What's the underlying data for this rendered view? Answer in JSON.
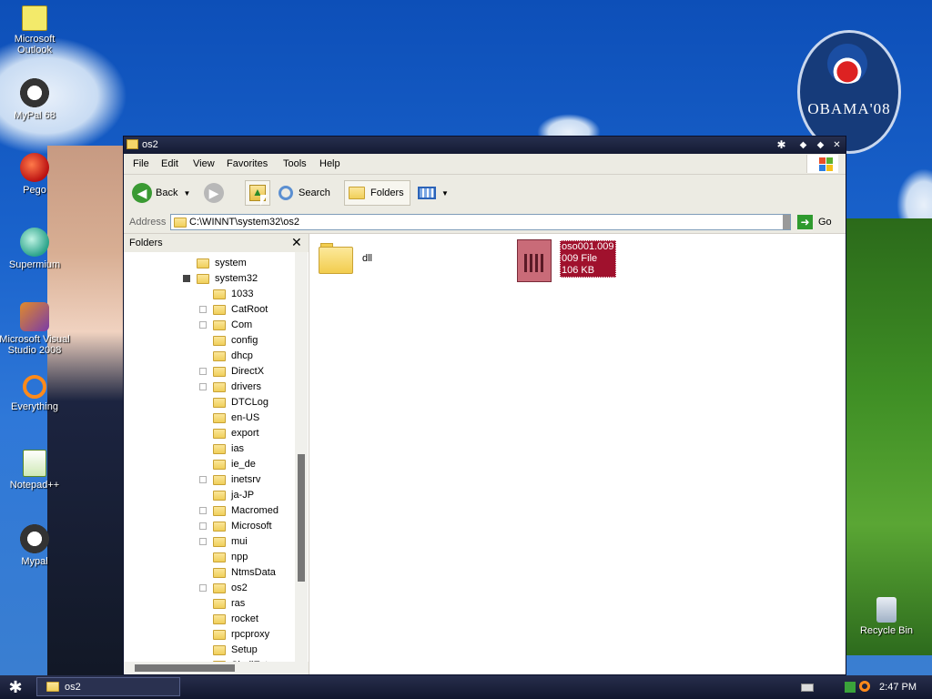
{
  "desktop": {
    "icons": [
      {
        "label": "Microsoft Outlook",
        "icon": "outlook-icon"
      },
      {
        "label": "MyPal 68",
        "icon": "mypal-icon"
      },
      {
        "label": "Pego",
        "icon": "pego-icon"
      },
      {
        "label": "Supermium",
        "icon": "supermium-icon"
      },
      {
        "label": "Microsoft Visual Studio 2008",
        "icon": "visual-studio-icon"
      },
      {
        "label": "Everything",
        "icon": "everything-icon"
      },
      {
        "label": "Notepad++",
        "icon": "notepad-plus-plus-icon"
      },
      {
        "label": "Mypal",
        "icon": "mypal-icon"
      }
    ],
    "recycle_bin": "Recycle Bin",
    "seal_text": "OBAMA'08"
  },
  "window": {
    "title": "os2",
    "menu": [
      "File",
      "Edit",
      "View",
      "Favorites",
      "Tools",
      "Help"
    ],
    "toolbar": {
      "back_label": "Back",
      "search_label": "Search",
      "folders_label": "Folders"
    },
    "address": {
      "label": "Address",
      "value": "C:\\WINNT\\system32\\os2",
      "go_label": "Go"
    },
    "folders_pane": {
      "title": "Folders",
      "items": [
        {
          "label": "system",
          "level": 0,
          "expander": false
        },
        {
          "label": "system32",
          "level": 0,
          "expander": true
        },
        {
          "label": "1033",
          "level": 1,
          "expander": false
        },
        {
          "label": "CatRoot",
          "level": 1,
          "expander": true
        },
        {
          "label": "Com",
          "level": 1,
          "expander": true
        },
        {
          "label": "config",
          "level": 1,
          "expander": false
        },
        {
          "label": "dhcp",
          "level": 1,
          "expander": false
        },
        {
          "label": "DirectX",
          "level": 1,
          "expander": true
        },
        {
          "label": "drivers",
          "level": 1,
          "expander": true
        },
        {
          "label": "DTCLog",
          "level": 1,
          "expander": false
        },
        {
          "label": "en-US",
          "level": 1,
          "expander": false
        },
        {
          "label": "export",
          "level": 1,
          "expander": false
        },
        {
          "label": "ias",
          "level": 1,
          "expander": false
        },
        {
          "label": "ie_de",
          "level": 1,
          "expander": false
        },
        {
          "label": "inetsrv",
          "level": 1,
          "expander": true
        },
        {
          "label": "ja-JP",
          "level": 1,
          "expander": false
        },
        {
          "label": "Macromed",
          "level": 1,
          "expander": true
        },
        {
          "label": "Microsoft",
          "level": 1,
          "expander": true
        },
        {
          "label": "mui",
          "level": 1,
          "expander": true
        },
        {
          "label": "npp",
          "level": 1,
          "expander": false
        },
        {
          "label": "NtmsData",
          "level": 1,
          "expander": false
        },
        {
          "label": "os2",
          "level": 1,
          "expander": true
        },
        {
          "label": "ras",
          "level": 1,
          "expander": false
        },
        {
          "label": "rocket",
          "level": 1,
          "expander": false
        },
        {
          "label": "rpcproxy",
          "level": 1,
          "expander": false
        },
        {
          "label": "Setup",
          "level": 1,
          "expander": false
        },
        {
          "label": "ShellExt",
          "level": 1,
          "expander": false
        }
      ]
    },
    "content": {
      "folder_name": "dll",
      "file": {
        "name": "oso001.009",
        "type": "009 File",
        "size": "106 KB"
      }
    }
  },
  "taskbar": {
    "task_label": "os2",
    "clock": "2:47 PM"
  }
}
